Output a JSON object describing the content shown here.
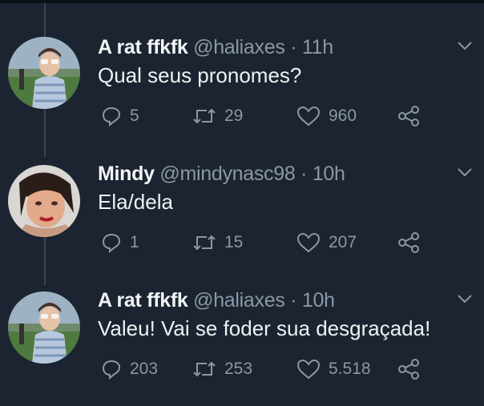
{
  "tweets": [
    {
      "name": "A rat ffkfk",
      "handle": "@haliaxes",
      "separator": "·",
      "time": "11h",
      "text": "Qual seus pronomes?",
      "replies": "5",
      "retweets": "29",
      "likes": "960"
    },
    {
      "name": "Mindy",
      "handle": "@mindynasc98",
      "separator": "·",
      "time": "10h",
      "text": "Ela/dela",
      "replies": "1",
      "retweets": "15",
      "likes": "207"
    },
    {
      "name": "A rat ffkfk",
      "handle": "@haliaxes",
      "separator": "·",
      "time": "10h",
      "text": "Valeu! Vai se foder sua desgraçada!",
      "replies": "203",
      "retweets": "253",
      "likes": "5.518"
    }
  ],
  "icons": {
    "reply": "reply-icon",
    "retweet": "retweet-icon",
    "like": "heart-icon",
    "share": "share-icon",
    "menu": "chevron-down-icon"
  },
  "colors": {
    "background": "#1b2430",
    "text": "#eef1f3",
    "muted": "#8b98a5",
    "thread_line": "#3b4654"
  }
}
